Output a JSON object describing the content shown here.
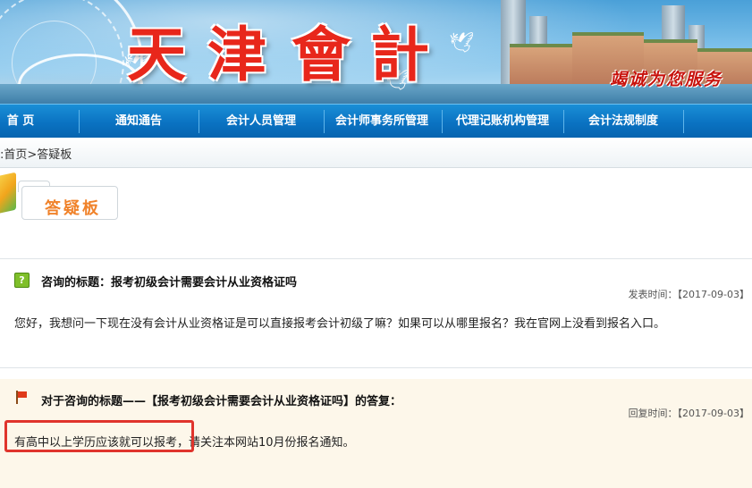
{
  "header": {
    "logo_chars": [
      "天",
      "津",
      "會",
      "計"
    ],
    "slogan": "竭诚为您服务"
  },
  "nav": {
    "items": [
      {
        "label": "首  页"
      },
      {
        "label": "通知通告"
      },
      {
        "label": "会计人员管理"
      },
      {
        "label": "会计师事务所管理"
      },
      {
        "label": "代理记账机构管理"
      },
      {
        "label": "会计法规制度"
      }
    ]
  },
  "breadcrumb": ":首页>答疑板",
  "page_title": "答疑板",
  "question": {
    "title": "咨询的标题：报考初级会计需要会计从业资格证吗",
    "meta": "发表时间：【2017-09-03】",
    "body": "您好，我想问一下现在没有会计从业资格证是可以直接报考会计初级了嘛？如果可以从哪里报名？我在官网上没看到报名入口。"
  },
  "answer": {
    "title": "对于咨询的标题——【报考初级会计需要会计从业资格证吗】的答复：",
    "meta": "回复时间：【2017-09-03】",
    "body": "有高中以上学历应该就可以报考，请关注本网站10月份报名通知。"
  },
  "colors": {
    "nav_bg": "#0a72c2",
    "logo_red": "#e8271b",
    "title_orange": "#f0822a",
    "highlight_red": "#e0342c",
    "answer_bg": "#fdf7ea"
  }
}
